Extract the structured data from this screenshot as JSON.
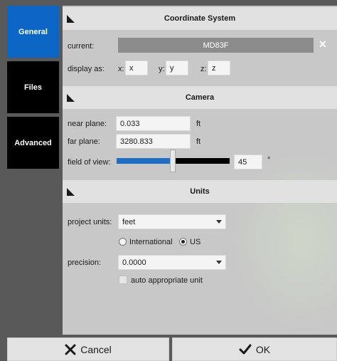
{
  "tabs": [
    {
      "label": "General",
      "active": true
    },
    {
      "label": "Files",
      "active": false
    },
    {
      "label": "Advanced",
      "active": false
    }
  ],
  "coordinate_system": {
    "title": "Coordinate System",
    "current_label": "current:",
    "current_value": "MD83F",
    "display_as_label": "display as:",
    "x_label": "x:",
    "x_value": "x",
    "y_label": "y:",
    "y_value": "y",
    "z_label": "z:",
    "z_value": "z"
  },
  "camera": {
    "title": "Camera",
    "near_plane_label": "near plane:",
    "near_plane_value": "0.033",
    "near_plane_unit": "ft",
    "far_plane_label": "far plane:",
    "far_plane_value": "3280.833",
    "far_plane_unit": "ft",
    "fov_label": "field of view:",
    "fov_value": "45",
    "fov_unit": "°",
    "fov_slider_fraction": 0.5
  },
  "units": {
    "title": "Units",
    "project_units_label": "project units:",
    "project_units_value": "feet",
    "international_label": "International",
    "us_label": "US",
    "selected": "US",
    "precision_label": "precision:",
    "precision_value": "0.0000",
    "auto_unit_label": "auto appropriate unit",
    "auto_unit_checked": false
  },
  "footer": {
    "cancel_label": "Cancel",
    "ok_label": "OK"
  },
  "colors": {
    "accent": "#0b66c6",
    "slider_fill": "#1e6fc4"
  }
}
